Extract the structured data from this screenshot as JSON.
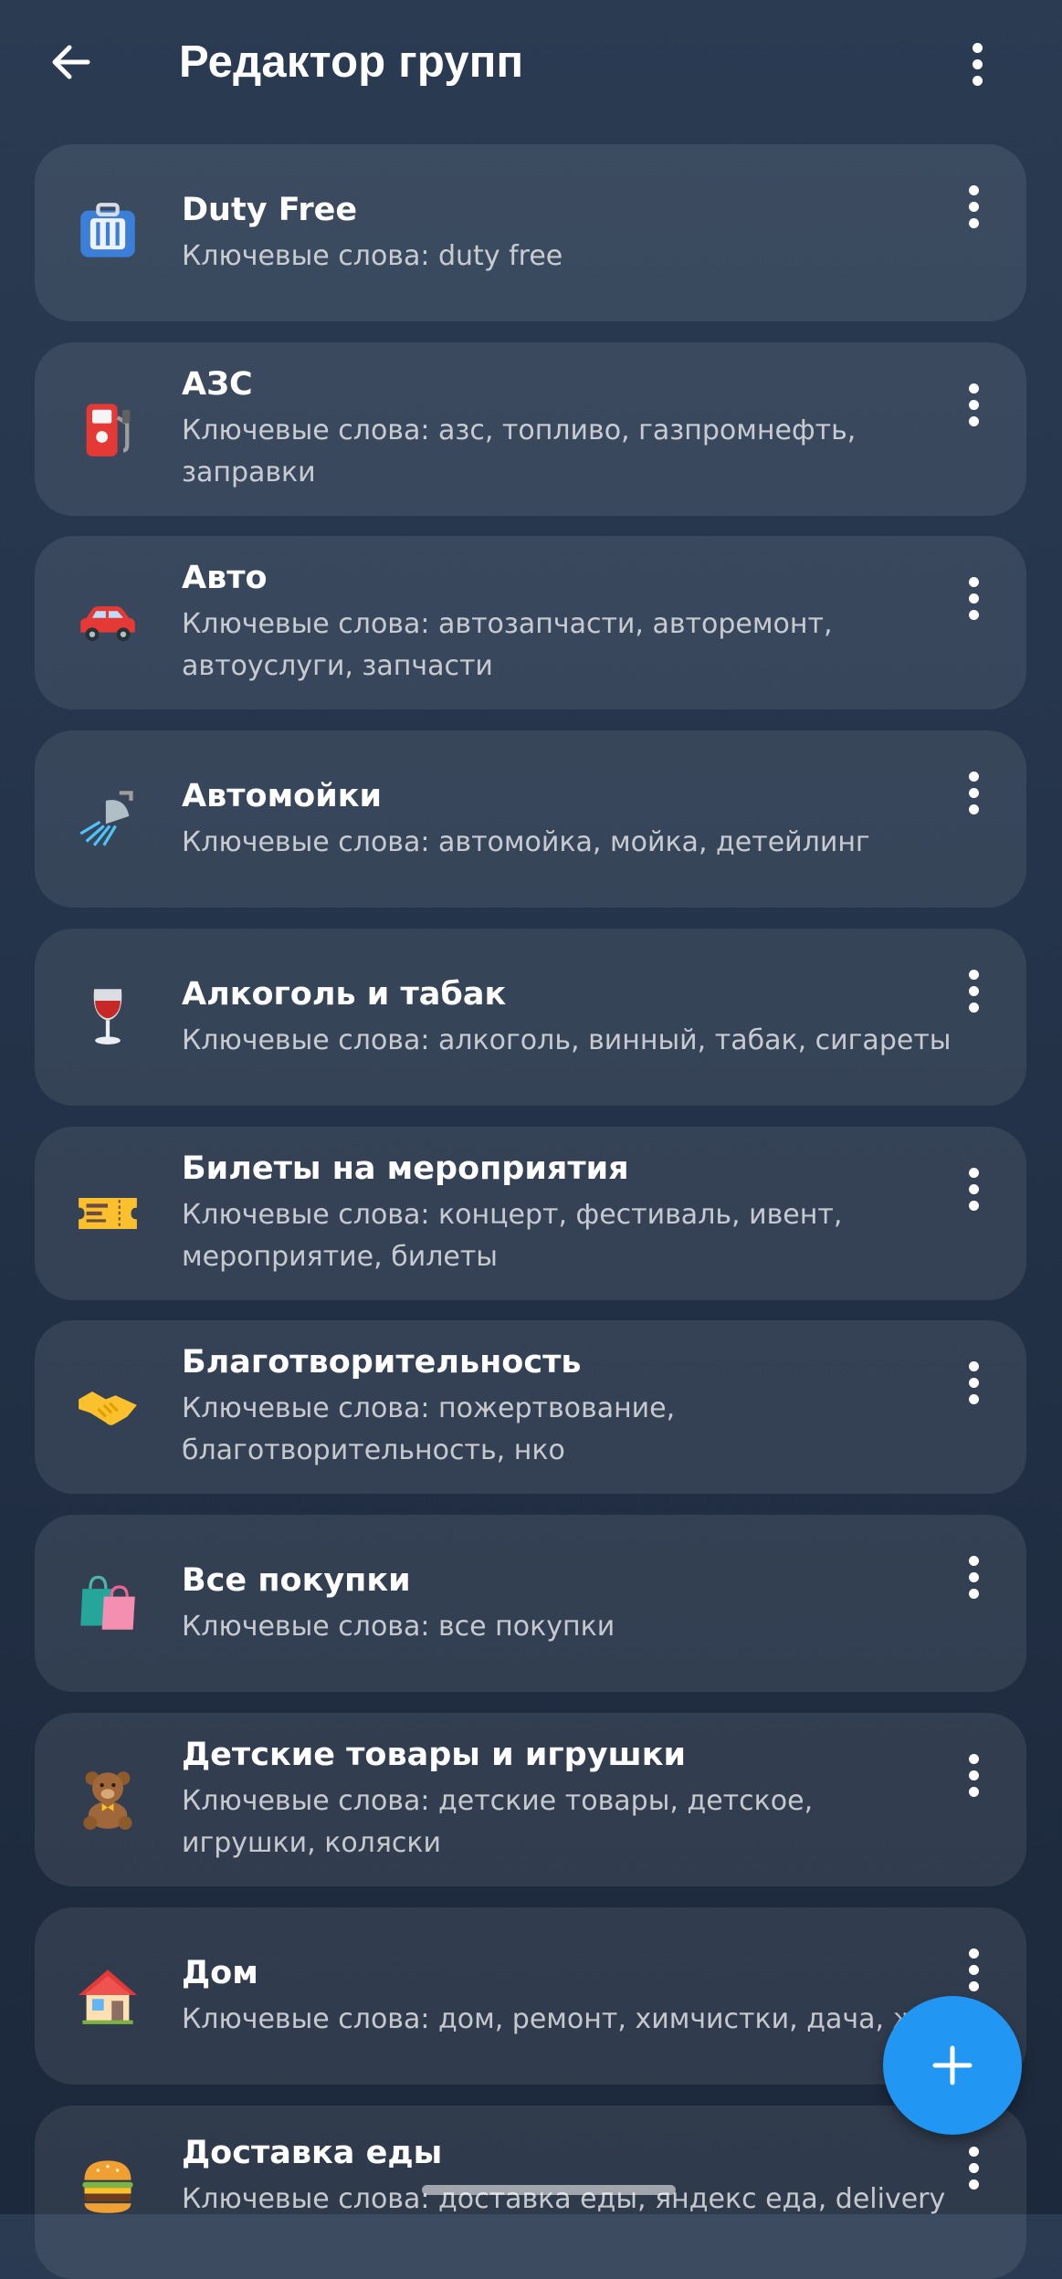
{
  "header": {
    "title": "Редактор групп",
    "back_icon": "arrow-left-icon",
    "menu_icon": "more-vertical-icon"
  },
  "keywords_prefix": "Ключевые слова: ",
  "groups": [
    {
      "name": "Duty Free",
      "keywords": "Ключевые слова: duty free",
      "icon": "luggage-icon"
    },
    {
      "name": "АЗС",
      "keywords": "Ключевые слова: азс, топливо, газпромнефть, заправки",
      "icon": "fuel-pump-icon"
    },
    {
      "name": "Авто",
      "keywords": "Ключевые слова: автозапчасти, авторемонт, автоуслуги, запчасти",
      "icon": "car-icon"
    },
    {
      "name": "Автомойки",
      "keywords": "Ключевые слова: автомойка, мойка, детейлинг",
      "icon": "shower-icon"
    },
    {
      "name": "Алкоголь и табак",
      "keywords": "Ключевые слова: алкоголь, винный, табак, сигареты",
      "icon": "wine-glass-icon"
    },
    {
      "name": "Билеты на мероприятия",
      "keywords": "Ключевые слова: концерт, фестиваль, ивент, мероприятие, билеты",
      "icon": "ticket-icon"
    },
    {
      "name": "Благотворительность",
      "keywords": "Ключевые слова: пожертвование, благотворительность, нко",
      "icon": "handshake-icon"
    },
    {
      "name": "Все покупки",
      "keywords": "Ключевые слова: все покупки",
      "icon": "shopping-bags-icon"
    },
    {
      "name": "Детские товары и игрушки",
      "keywords": "Ключевые слова: детские товары, детское, игрушки, коляски",
      "icon": "teddy-bear-icon"
    },
    {
      "name": "Дом",
      "keywords": "Ключевые слова: дом, ремонт, химчистки, дача, ж",
      "icon": "house-icon"
    },
    {
      "name": "Доставка еды",
      "keywords": "Ключевые слова: доставка еды, яндекс еда, delivery",
      "icon": "burger-icon"
    }
  ],
  "fab": {
    "icon": "plus-icon"
  },
  "colors": {
    "background_top": "#2a3b52",
    "background_bottom": "#1c283b",
    "card": "#3a4a5f",
    "fab": "#2196f3",
    "text_primary": "#ffffff",
    "text_secondary": "#b8c0cc"
  }
}
